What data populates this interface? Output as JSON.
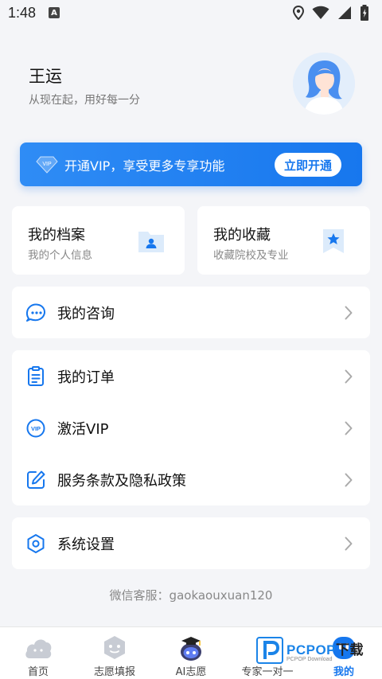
{
  "status_bar": {
    "time": "1:48",
    "notification_letter": "A"
  },
  "profile": {
    "name": "王运",
    "slogan": "从现在起，用好每一分"
  },
  "vip_banner": {
    "text": "开通VIP，享受更多专享功能",
    "button_label": "立即开通",
    "diamond_label": "VIP"
  },
  "cards": {
    "archive": {
      "title": "我的档案",
      "subtitle": "我的个人信息"
    },
    "favorites": {
      "title": "我的收藏",
      "subtitle": "收藏院校及专业"
    }
  },
  "menu": {
    "consult": "我的咨询",
    "orders": "我的订单",
    "activate_vip": "激活VIP",
    "terms": "服务条款及隐私政策",
    "settings": "系统设置",
    "vip_badge": "VIP"
  },
  "service_contact": "微信客服：gaokaouxuan120",
  "bottom_nav": {
    "home": "首页",
    "fill": "志愿填报",
    "ai": "AI志愿",
    "expert": "专家一对一",
    "mine": "我的"
  },
  "watermark": {
    "main_blue": "PCPOP",
    "main_dark": "下载",
    "sub": "PCPOP Download"
  },
  "colors": {
    "accent": "#1677ee",
    "background": "#f4f5f8"
  }
}
